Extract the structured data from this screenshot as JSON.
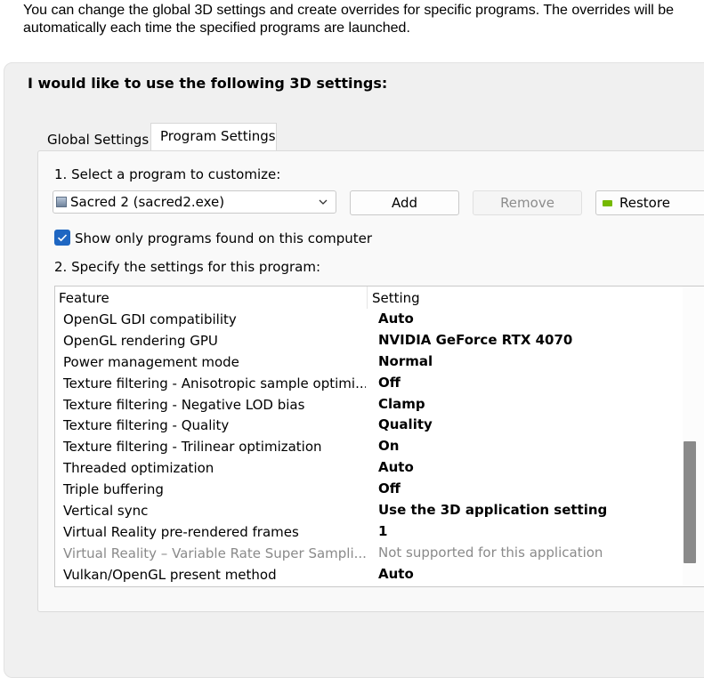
{
  "intro_text": "You can change the global 3D settings and create overrides for specific programs. The overrides will be automatically each time the specified programs are launched.",
  "heading": "I would like to use the following 3D settings:",
  "tabs": [
    {
      "label": "Global Settings",
      "selected": false
    },
    {
      "label": "Program Settings",
      "selected": true
    }
  ],
  "step1_label": "1. Select a program to customize:",
  "program_select": {
    "value": "Sacred 2 (sacred2.exe)"
  },
  "buttons": {
    "add": "Add",
    "remove": "Remove",
    "restore": "Restore"
  },
  "checkbox": {
    "label": "Show only programs found on this computer",
    "checked": true
  },
  "step2_label": "2. Specify the settings for this program:",
  "table": {
    "columns": [
      "Feature",
      "Setting"
    ],
    "rows": [
      {
        "feature": "OpenGL GDI compatibility",
        "setting": "Auto",
        "enabled": true
      },
      {
        "feature": "OpenGL rendering GPU",
        "setting": "NVIDIA GeForce RTX 4070",
        "enabled": true
      },
      {
        "feature": "Power management mode",
        "setting": "Normal",
        "enabled": true
      },
      {
        "feature": "Texture filtering - Anisotropic sample optimi...",
        "setting": "Off",
        "enabled": true
      },
      {
        "feature": "Texture filtering - Negative LOD bias",
        "setting": "Clamp",
        "enabled": true
      },
      {
        "feature": "Texture filtering - Quality",
        "setting": "Quality",
        "enabled": true
      },
      {
        "feature": "Texture filtering - Trilinear optimization",
        "setting": "On",
        "enabled": true
      },
      {
        "feature": "Threaded optimization",
        "setting": "Auto",
        "enabled": true
      },
      {
        "feature": "Triple buffering",
        "setting": "Off",
        "enabled": true
      },
      {
        "feature": "Vertical sync",
        "setting": "Use the 3D application setting",
        "enabled": true
      },
      {
        "feature": "Virtual Reality pre-rendered frames",
        "setting": "1",
        "enabled": true
      },
      {
        "feature": "Virtual Reality – Variable Rate Super Sampli...",
        "setting": "Not supported for this application",
        "enabled": false
      },
      {
        "feature": "Vulkan/OpenGL present method",
        "setting": "Auto",
        "enabled": true
      }
    ]
  },
  "colors": {
    "accent": "#1e66c2",
    "nvidia_green": "#76b900",
    "disabled_text": "#8a8a8a"
  },
  "icons": {
    "program": "app-icon",
    "dropdown": "chevron-down-icon",
    "restore": "nvidia-icon",
    "check": "check-icon"
  }
}
